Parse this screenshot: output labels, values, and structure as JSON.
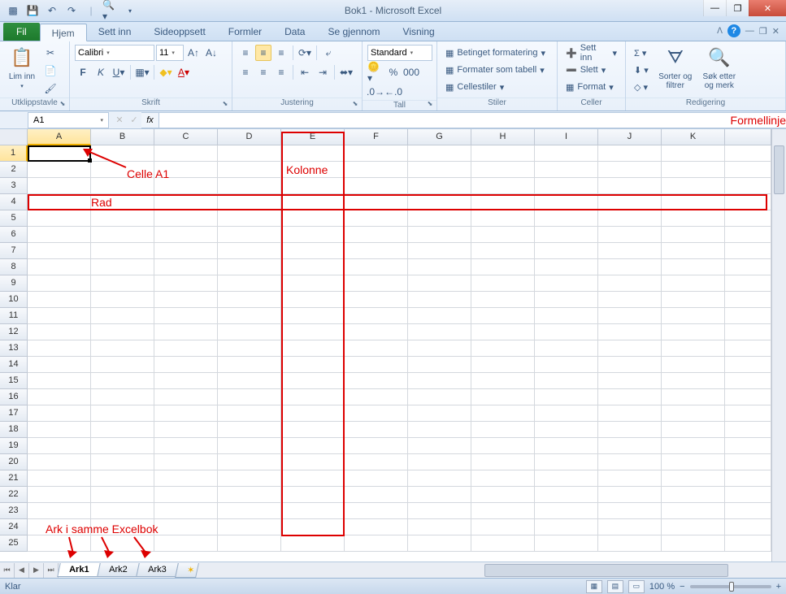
{
  "title": "Bok1 - Microsoft Excel",
  "tabs": {
    "file": "Fil",
    "list": [
      "Hjem",
      "Sett inn",
      "Sideoppsett",
      "Formler",
      "Data",
      "Se gjennom",
      "Visning"
    ],
    "active": 0
  },
  "clipboard": {
    "lim_inn": "Lim inn",
    "label": "Utklippstavle"
  },
  "font": {
    "name": "Calibri",
    "size": "11",
    "label": "Skrift"
  },
  "align": {
    "label": "Justering"
  },
  "number": {
    "format": "Standard",
    "label": "Tall"
  },
  "styles": {
    "cond": "Betinget formatering",
    "table": "Formater som tabell",
    "cell": "Cellestiler",
    "label": "Stiler"
  },
  "cells": {
    "insert": "Sett inn",
    "delete": "Slett",
    "format": "Format",
    "label": "Celler"
  },
  "editing": {
    "sort": "Sorter og filtrer",
    "find": "Søk etter og merk",
    "label": "Redigering"
  },
  "namebox": "A1",
  "columns": [
    "A",
    "B",
    "C",
    "D",
    "E",
    "F",
    "G",
    "H",
    "I",
    "J",
    "K"
  ],
  "rows": [
    1,
    2,
    3,
    4,
    5,
    6,
    7,
    8,
    9,
    10,
    11,
    12,
    13,
    14,
    15,
    16,
    17,
    18,
    19,
    20,
    21,
    22,
    23,
    24,
    25
  ],
  "active_cell": "A1",
  "annotations": {
    "formellinje": "Formellinje",
    "celle": "Celle A1",
    "kolonne": "Kolonne",
    "rad": "Rad",
    "ark": "Ark i samme Excelbok"
  },
  "sheets": {
    "list": [
      "Ark1",
      "Ark2",
      "Ark3"
    ],
    "active": 0
  },
  "status": {
    "ready": "Klar",
    "zoom": "100 %"
  }
}
